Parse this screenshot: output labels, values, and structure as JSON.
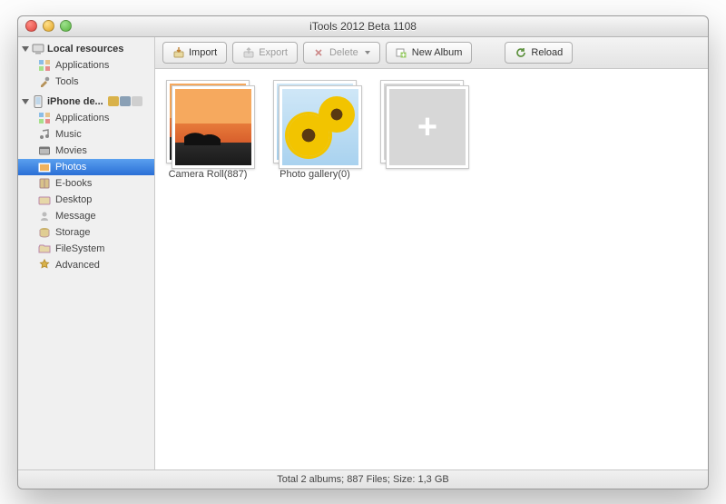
{
  "window": {
    "title": "iTools 2012 Beta 1108"
  },
  "sidebar": {
    "group1": {
      "label": "Local resources",
      "items": [
        {
          "label": "Applications",
          "icon": "apps"
        },
        {
          "label": "Tools",
          "icon": "tools"
        }
      ]
    },
    "group2": {
      "label": "iPhone de...",
      "items": [
        {
          "label": "Applications",
          "icon": "apps"
        },
        {
          "label": "Music",
          "icon": "music"
        },
        {
          "label": "Movies",
          "icon": "movies"
        },
        {
          "label": "Photos",
          "icon": "photos"
        },
        {
          "label": "E-books",
          "icon": "ebooks"
        },
        {
          "label": "Desktop",
          "icon": "desktop"
        },
        {
          "label": "Message",
          "icon": "message"
        },
        {
          "label": "Storage",
          "icon": "storage"
        },
        {
          "label": "FileSystem",
          "icon": "filesystem"
        },
        {
          "label": "Advanced",
          "icon": "advanced"
        }
      ]
    }
  },
  "toolbar": {
    "import_label": "Import",
    "export_label": "Export",
    "delete_label": "Delete",
    "newalbum_label": "New Album",
    "reload_label": "Reload"
  },
  "albums": [
    {
      "label": "Camera Roll(887)"
    },
    {
      "label": "Photo gallery(0)"
    }
  ],
  "status": {
    "text": "Total 2 albums; 887 Files;  Size: 1,3 GB"
  }
}
